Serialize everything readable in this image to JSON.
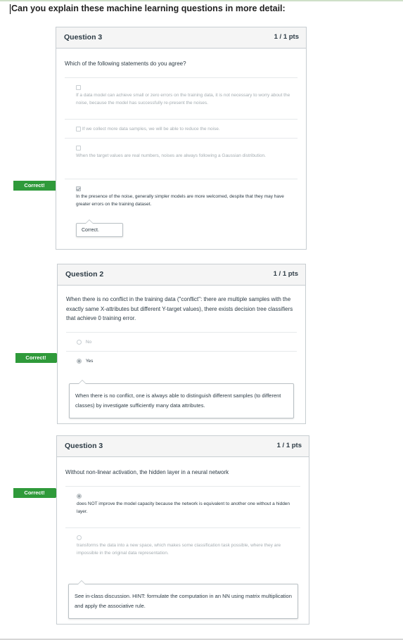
{
  "page_title": "Can you explain these machine learning questions in more detail:",
  "correct_label": "Correct!",
  "questions": [
    {
      "title": "Question 3",
      "points": "1 / 1 pts",
      "text": "Which of the following statements do you agree?",
      "answers": [
        {
          "text": "If a data model can achieve small or zero errors on the training data, it is not necessary to worry about the noise, because the model has successfully re-present the noises.",
          "selected": false
        },
        {
          "text": "If we collect more data samples, we will be able to reduce the noise.",
          "selected": false
        },
        {
          "text": "When the target values are real numbers, noises are always following a Gaussian distribution.",
          "selected": false
        },
        {
          "text": "In the presence of the noise, generally simpler models are more welcomed, despite that they may have greater errors on the training dataset.",
          "selected": true
        }
      ],
      "comment": "Correct."
    },
    {
      "title": "Question 2",
      "points": "1 / 1 pts",
      "text": "When there is no conflict in the training data (\"conflict\": there are multiple samples with the exactly same X-attributes but different Y-target values),  there exists decision tree classifiers that achieve 0 training error.",
      "answers": [
        {
          "text": "No",
          "selected": false
        },
        {
          "text": "Yes",
          "selected": true
        }
      ],
      "comment": "When there is no conflict, one is always able to distinguish different samples (to different classes) by investigate sufficiently many data attributes."
    },
    {
      "title": "Question 3",
      "points": "1 / 1 pts",
      "text": "Without non-linear activation, the hidden layer in a neural network",
      "answers": [
        {
          "text": "does NOT improve the model capacity because the network is equivalent to another one without a hidden layer.",
          "selected": true
        },
        {
          "text": "transforms the data into a new space, which makes some classification task possible, where they are impossible in the original data representation.",
          "selected": false
        }
      ],
      "comment": "See in-class discussion. HINT: formulate the computation in an NN using matrix multiplication and apply the associative rule."
    }
  ]
}
